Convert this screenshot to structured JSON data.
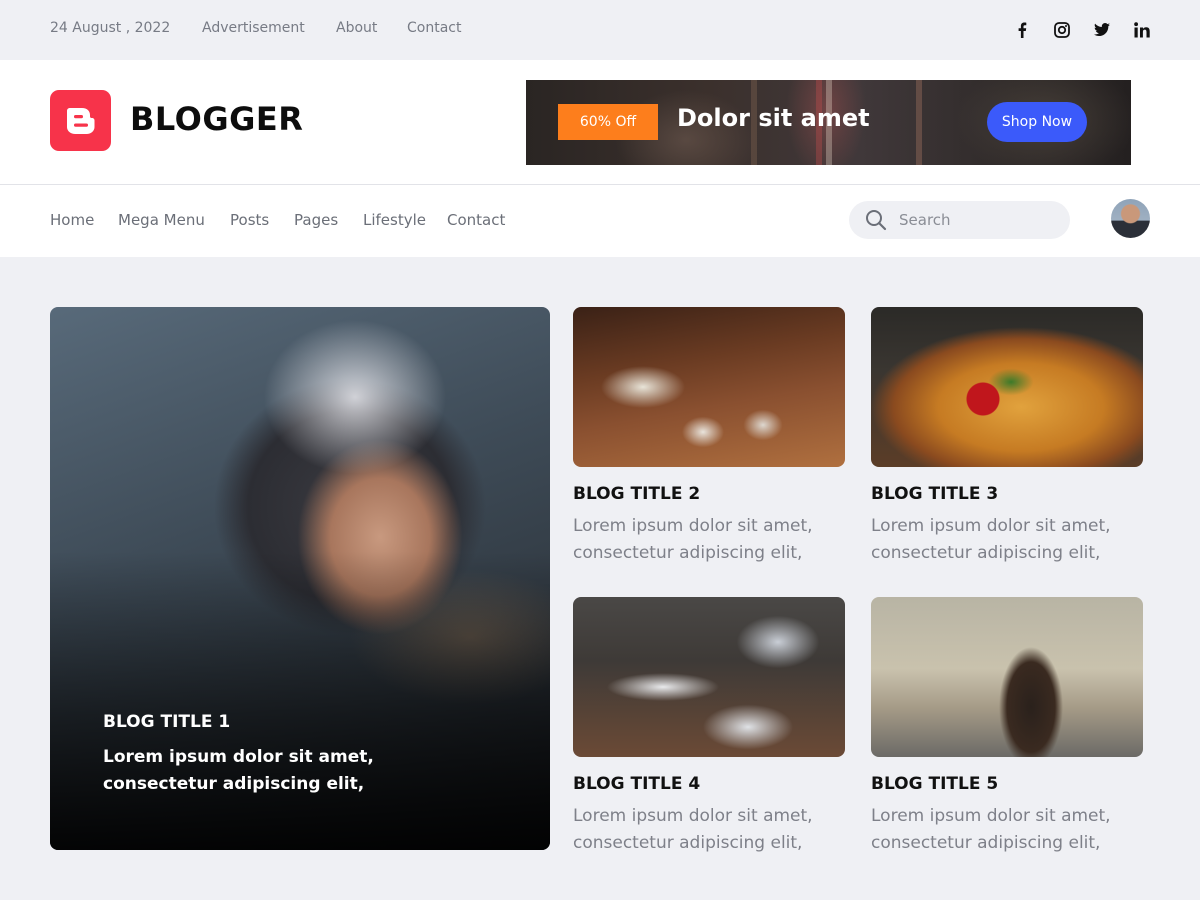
{
  "topbar": {
    "date": "24 August , 2022",
    "links": [
      "Advertisement",
      "About",
      "Contact"
    ],
    "social": [
      "facebook-icon",
      "instagram-icon",
      "twitter-icon",
      "linkedin-icon"
    ]
  },
  "header": {
    "brand": "BLOGGER",
    "logo_color": "#f7334a",
    "banner": {
      "badge": "60% Off",
      "title": "Dolor sit amet",
      "button": "Shop Now",
      "badge_color": "#fd7e1c",
      "button_color": "#3b5afa"
    }
  },
  "nav": {
    "items": [
      "Home",
      "Mega Menu",
      "Posts",
      "Pages",
      "Lifestyle",
      "Contact"
    ],
    "search_placeholder": "Search"
  },
  "posts": [
    {
      "title": "BLOG TITLE 1",
      "desc": "Lorem ipsum dolor sit amet, consectetur adipiscing elit,"
    },
    {
      "title": "BLOG TITLE 2",
      "desc": "Lorem ipsum dolor sit amet, consectetur adipiscing elit,"
    },
    {
      "title": "BLOG TITLE 3",
      "desc": "Lorem ipsum dolor sit amet, consectetur adipiscing elit,"
    },
    {
      "title": "BLOG TITLE 4",
      "desc": "Lorem ipsum dolor sit amet, consectetur adipiscing elit,"
    },
    {
      "title": "BLOG TITLE 5",
      "desc": "Lorem ipsum dolor sit amet, consectetur adipiscing elit,"
    }
  ]
}
